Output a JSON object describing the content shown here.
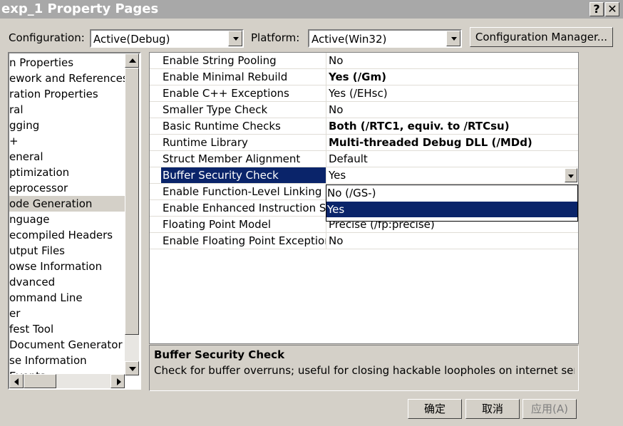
{
  "window": {
    "title": "exp_1 Property Pages",
    "help_glyph": "?",
    "close_glyph": "✕"
  },
  "toolbar": {
    "configuration_label": "Configuration:",
    "configuration_value": "Active(Debug)",
    "platform_label": "Platform:",
    "platform_value": "Active(Win32)",
    "config_manager_label": "Configuration Manager..."
  },
  "tree": {
    "items": [
      {
        "label": "n Properties"
      },
      {
        "label": "ework and References"
      },
      {
        "label": "ration Properties"
      },
      {
        "label": "ral"
      },
      {
        "label": "gging"
      },
      {
        "label": "+"
      },
      {
        "label": "eneral"
      },
      {
        "label": "ptimization"
      },
      {
        "label": "eprocessor"
      },
      {
        "label": "ode Generation",
        "selected": true
      },
      {
        "label": "nguage"
      },
      {
        "label": "ecompiled Headers"
      },
      {
        "label": "utput Files"
      },
      {
        "label": "owse Information"
      },
      {
        "label": "dvanced"
      },
      {
        "label": "ommand Line"
      },
      {
        "label": "er"
      },
      {
        "label": "fest Tool"
      },
      {
        "label": "Document Generator"
      },
      {
        "label": "se Information"
      },
      {
        "label": "Events"
      }
    ]
  },
  "properties": [
    {
      "name": "Enable String Pooling",
      "value": "No",
      "bold": false
    },
    {
      "name": "Enable Minimal Rebuild",
      "value": "Yes (/Gm)",
      "bold": true
    },
    {
      "name": "Enable C++ Exceptions",
      "value": "Yes (/EHsc)",
      "bold": false
    },
    {
      "name": "Smaller Type Check",
      "value": "No",
      "bold": false
    },
    {
      "name": "Basic Runtime Checks",
      "value": "Both (/RTC1, equiv. to /RTCsu)",
      "bold": true
    },
    {
      "name": "Runtime Library",
      "value": "Multi-threaded Debug DLL (/MDd)",
      "bold": true
    },
    {
      "name": "Struct Member Alignment",
      "value": "Default",
      "bold": false
    },
    {
      "name": "Buffer Security Check",
      "value": "Yes",
      "bold": false,
      "selected": true
    },
    {
      "name": "Enable Function-Level Linking",
      "value": "",
      "bold": false
    },
    {
      "name": "Enable Enhanced Instruction Set",
      "value": "",
      "bold": false
    },
    {
      "name": "Floating Point Model",
      "value": "Precise (/fp:precise)",
      "bold": false
    },
    {
      "name": "Enable Floating Point Exceptions",
      "value": "No",
      "bold": false
    }
  ],
  "dropdown": {
    "options": [
      {
        "label": "No (/GS-)",
        "selected": false
      },
      {
        "label": "Yes",
        "selected": true
      }
    ]
  },
  "description": {
    "title": "Buffer Security Check",
    "text": "Check for buffer overruns; useful for closing hackable loopholes on internet serv..."
  },
  "buttons": {
    "ok": "确定",
    "cancel": "取消",
    "apply": "应用(A)"
  },
  "colors": {
    "selection": "#0a246a",
    "face": "#d4d0c8",
    "titlebar": "#a8a8a8"
  }
}
